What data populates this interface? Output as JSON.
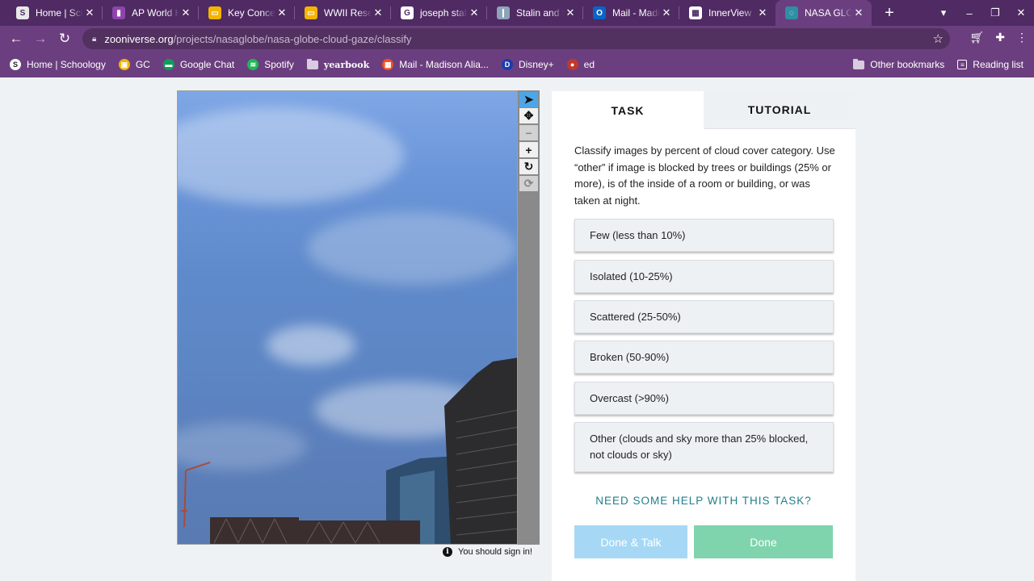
{
  "browser": {
    "tabs": [
      {
        "title": "Home | Schoology",
        "icon": "schoology-icon",
        "color": "#e8e8e8",
        "glyph": "S"
      },
      {
        "title": "AP World History",
        "icon": "classroom-icon",
        "color": "#8e44ad",
        "glyph": "▮"
      },
      {
        "title": "Key Concepts",
        "icon": "slides-icon",
        "color": "#f4b400",
        "glyph": "▭"
      },
      {
        "title": "WWII Research",
        "icon": "slides-icon",
        "color": "#f4b400",
        "glyph": "▭"
      },
      {
        "title": "joseph stalin",
        "icon": "google-icon",
        "color": "#ffffff",
        "glyph": "G"
      },
      {
        "title": "Stalin and the",
        "icon": "site-icon",
        "color": "#8fa3b8",
        "glyph": "❙"
      },
      {
        "title": "Mail - Madison",
        "icon": "outlook-icon",
        "color": "#0a64c8",
        "glyph": "O"
      },
      {
        "title": "InnerView",
        "icon": "innerview-icon",
        "color": "#ffffff",
        "glyph": "▦"
      },
      {
        "title": "NASA GLOBE",
        "icon": "zooniverse-icon",
        "color": "#2f8fa3",
        "glyph": "◌",
        "active": true
      }
    ],
    "new_tab": "+",
    "url_host": "zooniverse.org",
    "url_path": "/projects/nasaglobe/nasa-globe-cloud-gaze/classify",
    "bookmarks": [
      {
        "label": "Home | Schoology",
        "icon": "schoology-icon",
        "color": "#ffffff",
        "glyph": "S"
      },
      {
        "label": "GC",
        "icon": "classroom-icon",
        "color": "#f4b400",
        "glyph": "▣"
      },
      {
        "label": "Google Chat",
        "icon": "chat-icon",
        "color": "#0f9d58",
        "glyph": "▬"
      },
      {
        "label": "Spotify",
        "icon": "spotify-icon",
        "color": "#1db954",
        "glyph": "≋"
      },
      {
        "label": "yearbook",
        "icon": "folder-icon",
        "color": "#d9cce0",
        "glyph": ""
      },
      {
        "label": "Mail - Madison Alia...",
        "icon": "microsoft-icon",
        "color": "#f25022",
        "glyph": "▦"
      },
      {
        "label": "Disney+",
        "icon": "disney-icon",
        "color": "#1a3cb0",
        "glyph": "D"
      },
      {
        "label": "ed",
        "icon": "ed-icon",
        "color": "#c0392b",
        "glyph": "●"
      }
    ],
    "other_bookmarks": "Other bookmarks",
    "reading_list": "Reading list"
  },
  "viewer": {
    "signin_text": "You should sign in!"
  },
  "task_panel": {
    "tab_task": "TASK",
    "tab_tutorial": "TUTORIAL",
    "instructions": "Classify images by percent of cloud cover category. Use “other” if image is blocked by trees or buildings (25% or more), is of the inside of a room or building, or was taken at night.",
    "answers": [
      "Few (less than 10%)",
      "Isolated (10-25%)",
      "Scattered (25-50%)",
      "Broken (50-90%)",
      "Overcast (>90%)",
      "Other (clouds and sky more than 25% blocked, not clouds or sky)"
    ],
    "help_link": "NEED SOME HELP WITH THIS TASK?",
    "done_talk_label": "Done & Talk",
    "done_label": "Done"
  }
}
